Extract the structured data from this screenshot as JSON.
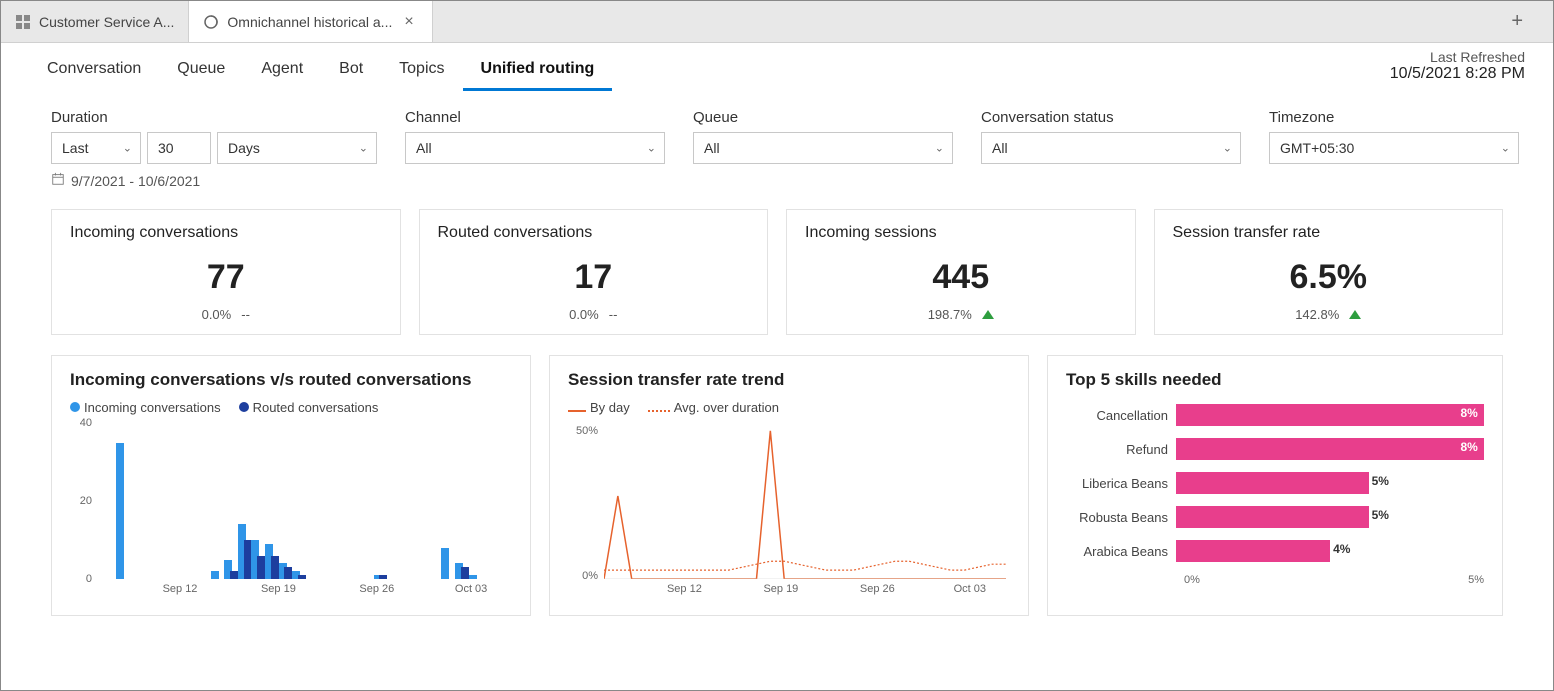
{
  "tabs": [
    {
      "label": "Customer Service A..."
    },
    {
      "label": "Omnichannel historical a..."
    }
  ],
  "nav": {
    "items": [
      "Conversation",
      "Queue",
      "Agent",
      "Bot",
      "Topics",
      "Unified routing"
    ]
  },
  "last_refreshed": {
    "label": "Last Refreshed",
    "value": "10/5/2021 8:28 PM"
  },
  "filters": {
    "duration_label": "Duration",
    "last": "Last",
    "n": "30",
    "unit": "Days",
    "channel_label": "Channel",
    "channel": "All",
    "queue_label": "Queue",
    "queue": "All",
    "status_label": "Conversation status",
    "status": "All",
    "tz_label": "Timezone",
    "tz": "GMT+05:30",
    "date_range": "9/7/2021 - 10/6/2021"
  },
  "kpi": [
    {
      "title": "Incoming conversations",
      "value": "77",
      "pct": "0.0%",
      "ind": "--"
    },
    {
      "title": "Routed conversations",
      "value": "17",
      "pct": "0.0%",
      "ind": "--"
    },
    {
      "title": "Incoming sessions",
      "value": "445",
      "pct": "198.7%",
      "ind": "up"
    },
    {
      "title": "Session transfer rate",
      "value": "6.5%",
      "pct": "142.8%",
      "ind": "up"
    }
  ],
  "chart1": {
    "title": "Incoming conversations v/s routed conversations",
    "legend_a": "Incoming conversations",
    "legend_b": "Routed conversations",
    "y_ticks": [
      "40",
      "20",
      "0"
    ],
    "x_ticks": [
      "Sep 12",
      "Sep 19",
      "Sep 26",
      "Oct 03"
    ]
  },
  "chart2": {
    "title": "Session transfer rate trend",
    "legend_a": "By day",
    "legend_b": "Avg. over duration",
    "y_ticks": [
      "50%",
      "0%"
    ],
    "x_ticks": [
      "Sep 12",
      "Sep 19",
      "Sep 26",
      "Oct 03"
    ]
  },
  "chart3": {
    "title": "Top 5 skills needed",
    "rows": [
      {
        "label": "Cancellation",
        "pct": 8,
        "txt": "8%"
      },
      {
        "label": "Refund",
        "pct": 8,
        "txt": "8%"
      },
      {
        "label": "Liberica Beans",
        "pct": 5,
        "txt": "5%"
      },
      {
        "label": "Robusta Beans",
        "pct": 5,
        "txt": "5%"
      },
      {
        "label": "Arabica Beans",
        "pct": 4,
        "txt": "4%"
      }
    ],
    "axis_min": "0%",
    "axis_max": "5%"
  },
  "chart_data": [
    {
      "type": "bar",
      "title": "Incoming conversations v/s routed conversations",
      "series": [
        {
          "name": "Incoming conversations",
          "values": [
            0,
            35,
            0,
            0,
            0,
            0,
            0,
            0,
            2,
            5,
            14,
            10,
            9,
            4,
            2,
            0,
            0,
            0,
            0,
            0,
            1,
            0,
            0,
            0,
            0,
            8,
            4,
            1,
            0,
            0
          ]
        },
        {
          "name": "Routed conversations",
          "values": [
            0,
            0,
            0,
            0,
            0,
            0,
            0,
            0,
            0,
            2,
            10,
            6,
            6,
            3,
            1,
            0,
            0,
            0,
            0,
            0,
            1,
            0,
            0,
            0,
            0,
            0,
            3,
            0,
            0,
            0
          ]
        }
      ],
      "categories_dates": "Sep 07..Oct 06",
      "x_tick_labels": [
        "Sep 12",
        "Sep 19",
        "Sep 26",
        "Oct 03"
      ],
      "ylabel": "count",
      "ylim": [
        0,
        40
      ]
    },
    {
      "type": "line",
      "title": "Session transfer rate trend",
      "series": [
        {
          "name": "By day",
          "values": [
            0,
            28,
            0,
            0,
            0,
            0,
            0,
            0,
            0,
            0,
            0,
            0,
            50,
            0,
            0,
            0,
            0,
            0,
            0,
            0,
            0,
            0,
            0,
            0,
            0,
            0,
            0,
            0,
            0,
            0
          ]
        },
        {
          "name": "Avg. over duration",
          "values": [
            3,
            3,
            3,
            3,
            3,
            3,
            3,
            3,
            3,
            3,
            4,
            5,
            6,
            6,
            5,
            4,
            3,
            3,
            3,
            4,
            5,
            6,
            6,
            5,
            4,
            3,
            3,
            4,
            5,
            5
          ]
        }
      ],
      "categories_dates": "Sep 07..Oct 06",
      "x_tick_labels": [
        "Sep 12",
        "Sep 19",
        "Sep 26",
        "Oct 03"
      ],
      "ylabel": "%",
      "ylim": [
        0,
        50
      ]
    },
    {
      "type": "bar",
      "title": "Top 5 skills needed",
      "orientation": "horizontal",
      "categories": [
        "Cancellation",
        "Refund",
        "Liberica Beans",
        "Robusta Beans",
        "Arabica Beans"
      ],
      "values": [
        8,
        8,
        5,
        5,
        4
      ],
      "xlabel": "%",
      "xlim": [
        0,
        8
      ]
    }
  ]
}
